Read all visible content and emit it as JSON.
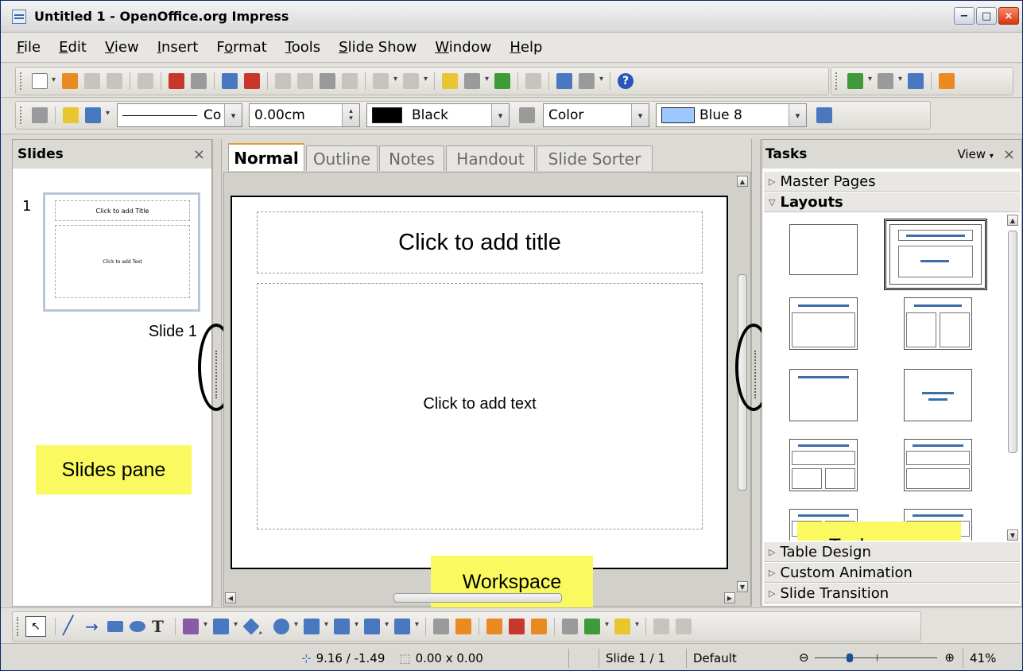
{
  "window": {
    "title": "Untitled 1 - OpenOffice.org Impress",
    "minimize": "−",
    "maximize": "□",
    "close": "×"
  },
  "menu": [
    {
      "pre": "",
      "ul": "F",
      "post": "ile"
    },
    {
      "pre": "",
      "ul": "E",
      "post": "dit"
    },
    {
      "pre": "",
      "ul": "V",
      "post": "iew"
    },
    {
      "pre": "",
      "ul": "I",
      "post": "nsert"
    },
    {
      "pre": "F",
      "ul": "o",
      "post": "rmat"
    },
    {
      "pre": "",
      "ul": "T",
      "post": "ools"
    },
    {
      "pre": "",
      "ul": "S",
      "post": "lide Show"
    },
    {
      "pre": "",
      "ul": "W",
      "post": "indow"
    },
    {
      "pre": "",
      "ul": "H",
      "post": "elp"
    }
  ],
  "line_toolbar": {
    "line_style": "Co",
    "line_width": "0.00cm",
    "line_color": "Black",
    "line_color_hex": "#000000",
    "area_style": "Color",
    "area_color": "Blue 8",
    "area_color_hex": "#9cc8ff"
  },
  "slides_pane": {
    "title": "Slides",
    "close": "×",
    "slide_number": "1",
    "thumb_title": "Click to add Title",
    "thumb_text": "Click to add Text",
    "slide_label": "Slide 1",
    "callout": "Slides pane"
  },
  "tabs": [
    "Normal",
    "Outline",
    "Notes",
    "Handout",
    "Slide Sorter"
  ],
  "slide": {
    "title_placeholder": "Click to add title",
    "text_placeholder": "Click to add text",
    "callout": "Workspace"
  },
  "tasks_pane": {
    "title": "Tasks",
    "view": "View",
    "close": "×",
    "sections": {
      "master_pages": "Master Pages",
      "layouts": "Layouts",
      "table_design": "Table Design",
      "custom_animation": "Custom Animation",
      "slide_transition": "Slide Transition"
    },
    "callout": "Tasks pane"
  },
  "status": {
    "position": "9.16 / -1.49",
    "size": "0.00 x 0.00",
    "slide": "Slide 1 / 1",
    "layout": "Default",
    "zoom": "41%",
    "zoom_minus": "⊖",
    "zoom_plus": "⊕"
  }
}
